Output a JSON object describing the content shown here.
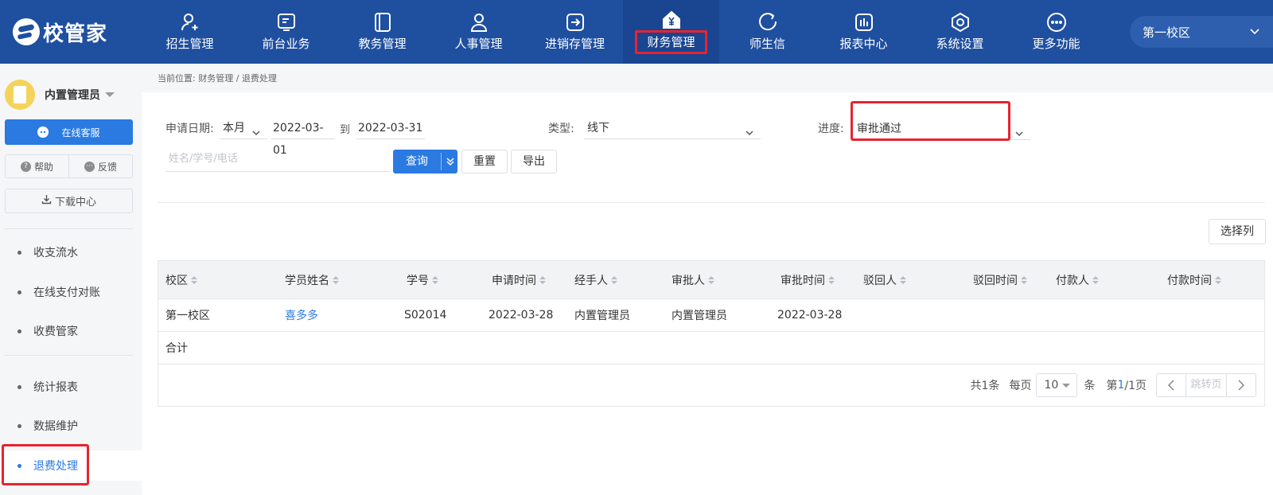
{
  "app": {
    "logo_text": "校管家"
  },
  "nav": [
    {
      "label": "招生管理",
      "icon": "person-add-icon"
    },
    {
      "label": "前台业务",
      "icon": "screen-icon"
    },
    {
      "label": "教务管理",
      "icon": "book-icon"
    },
    {
      "label": "人事管理",
      "icon": "person-icon"
    },
    {
      "label": "进销存管理",
      "icon": "arrow-box-icon"
    },
    {
      "label": "财务管理",
      "icon": "yen-house-icon",
      "active": true
    },
    {
      "label": "师生信",
      "icon": "chat-icon"
    },
    {
      "label": "报表中心",
      "icon": "chart-icon"
    },
    {
      "label": "系统设置",
      "icon": "settings-icon"
    },
    {
      "label": "更多功能",
      "icon": "more-icon"
    }
  ],
  "campus_selector": {
    "value": "第一校区"
  },
  "sidebar": {
    "user": "内置管理员",
    "service_button": "在线客服",
    "help": "帮助",
    "feedback": "反馈",
    "download": "下载中心",
    "menu": [
      "收支流水",
      "在线支付对账",
      "收费管家",
      "统计报表",
      "数据维护",
      "退费处理"
    ],
    "active_menu": "退费处理"
  },
  "breadcrumb": {
    "prefix": "当前位置:",
    "path": "财务管理 / 退费处理"
  },
  "filters": {
    "apply_date_label": "申请日期:",
    "period": "本月",
    "date_from": "2022-03-01",
    "to_label": "到",
    "date_to": "2022-03-31",
    "type_label": "类型:",
    "type_value": "线下",
    "progress_label": "进度:",
    "progress_value": "审批通过",
    "search_placeholder": "姓名/学号/电话",
    "query_button": "查询",
    "reset_button": "重置",
    "export_button": "导出",
    "columns_button": "选择列"
  },
  "table": {
    "columns": [
      "校区",
      "学员姓名",
      "学号",
      "申请时间",
      "经手人",
      "审批人",
      "审批时间",
      "驳回人",
      "驳回时间",
      "付款人",
      "付款时间"
    ],
    "rows": [
      [
        "第一校区",
        "喜多多",
        "S02014",
        "2022-03-28",
        "内置管理员",
        "内置管理员",
        "2022-03-28",
        "",
        "",
        "",
        ""
      ]
    ],
    "total_label": "合计"
  },
  "pagination": {
    "total_text": "共1条",
    "per_page_label": "每页",
    "per_page": "10",
    "unit": "条",
    "page_prefix": "第",
    "current_page": "1",
    "page_suffix": "/1页",
    "jump_placeholder": "跳转页"
  },
  "colors": {
    "nav_bg": "#1f4f9f",
    "accent": "#2a7ae2",
    "highlight_box": "#e8232f"
  }
}
